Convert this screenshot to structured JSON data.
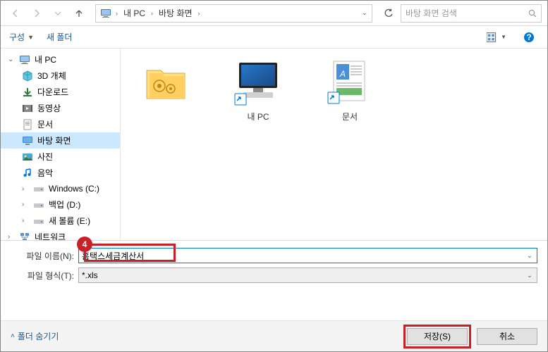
{
  "topbar": {
    "breadcrumb": [
      "내 PC",
      "바탕 화면"
    ],
    "search_placeholder": "바탕 화면 검색"
  },
  "toolbar": {
    "organize": "구성",
    "new_folder": "새 폴더"
  },
  "tree": {
    "items": [
      {
        "label": "내 PC",
        "icon": "pc",
        "indent": false,
        "exp": true
      },
      {
        "label": "3D 개체",
        "icon": "3d",
        "indent": true
      },
      {
        "label": "다운로드",
        "icon": "download",
        "indent": true
      },
      {
        "label": "동영상",
        "icon": "video",
        "indent": true
      },
      {
        "label": "문서",
        "icon": "doc",
        "indent": true
      },
      {
        "label": "바탕 화면",
        "icon": "desktop",
        "indent": true,
        "selected": true
      },
      {
        "label": "사진",
        "icon": "photo",
        "indent": true
      },
      {
        "label": "음악",
        "icon": "music",
        "indent": true
      },
      {
        "label": "Windows (C:)",
        "icon": "drive",
        "indent": true,
        "exp": true
      },
      {
        "label": "백업 (D:)",
        "icon": "drive",
        "indent": true,
        "exp": true
      },
      {
        "label": "새 볼륨 (E:)",
        "icon": "drive",
        "indent": true,
        "exp": true
      },
      {
        "label": "네트워크",
        "icon": "network",
        "indent": false,
        "exp": true
      }
    ]
  },
  "content": {
    "items": [
      {
        "label": "",
        "type": "folder-gear"
      },
      {
        "label": "내 PC",
        "type": "pc-shortcut"
      },
      {
        "label": "문서",
        "type": "doc-shortcut"
      }
    ]
  },
  "bottom": {
    "filename_label": "파일 이름(N):",
    "filename_value": "홈택스세금계산서",
    "filetype_label": "파일 형식(T):",
    "filetype_value": "*.xls",
    "badge": "4"
  },
  "footer": {
    "hide_folders": "폴더 숨기기",
    "save": "저장(S)",
    "cancel": "취소"
  }
}
